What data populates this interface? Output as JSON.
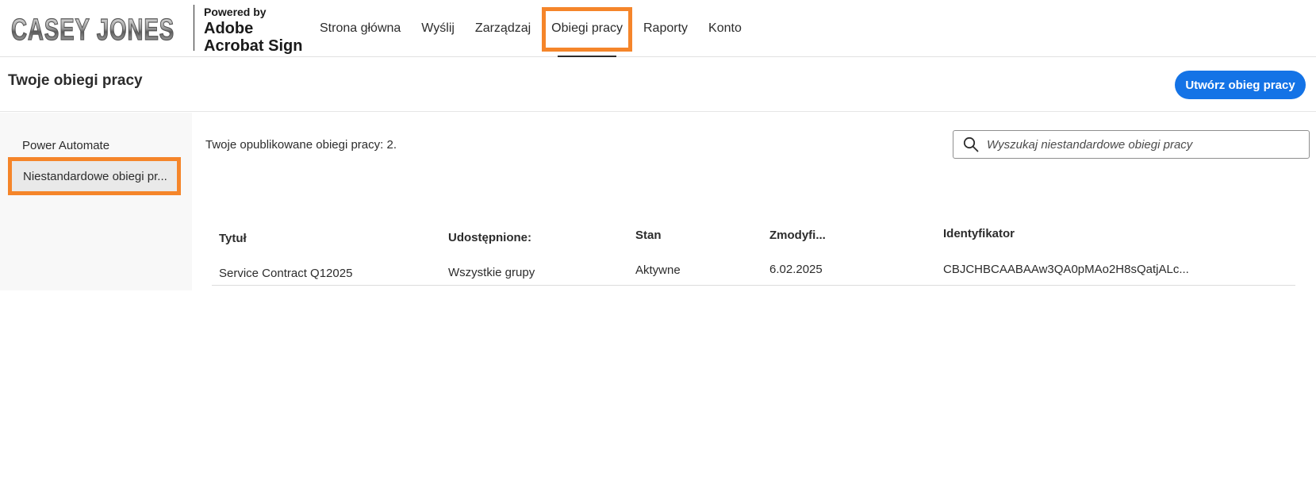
{
  "header": {
    "logo_text": "CASEY JONES",
    "powered_by": "Powered by",
    "product_line1": "Adobe",
    "product_line2": "Acrobat Sign",
    "nav": [
      {
        "label": "Strona główna"
      },
      {
        "label": "Wyślij"
      },
      {
        "label": "Zarządzaj"
      },
      {
        "label": "Obiegi pracy"
      },
      {
        "label": "Raporty"
      },
      {
        "label": "Konto"
      }
    ]
  },
  "titlebar": {
    "title": "Twoje obiegi pracy",
    "create_button": "Utwórz obieg pracy"
  },
  "sidebar": {
    "items": [
      {
        "label": "Power Automate"
      },
      {
        "label": "Niestandardowe obiegi pr..."
      }
    ]
  },
  "main": {
    "count_text": "Twoje opublikowane obiegi pracy: 2.",
    "search_placeholder": "Wyszukaj niestandardowe obiegi pracy",
    "columns": [
      "Tytuł",
      "Udostępnione:",
      "Stan",
      "Zmodyfi...",
      "Identyfikator"
    ],
    "rows": [
      [
        "Service Contract Q12025",
        "Wszystkie grupy",
        "Aktywne",
        "6.02.2025",
        "CBJCHBCAABAAw3QA0pMAo2H8sQatjALc..."
      ]
    ]
  },
  "colors": {
    "accent": "#1473e6",
    "highlight": "#f5852a"
  },
  "icons": {
    "search": "search-icon",
    "logo": "casey-jones-logo"
  }
}
